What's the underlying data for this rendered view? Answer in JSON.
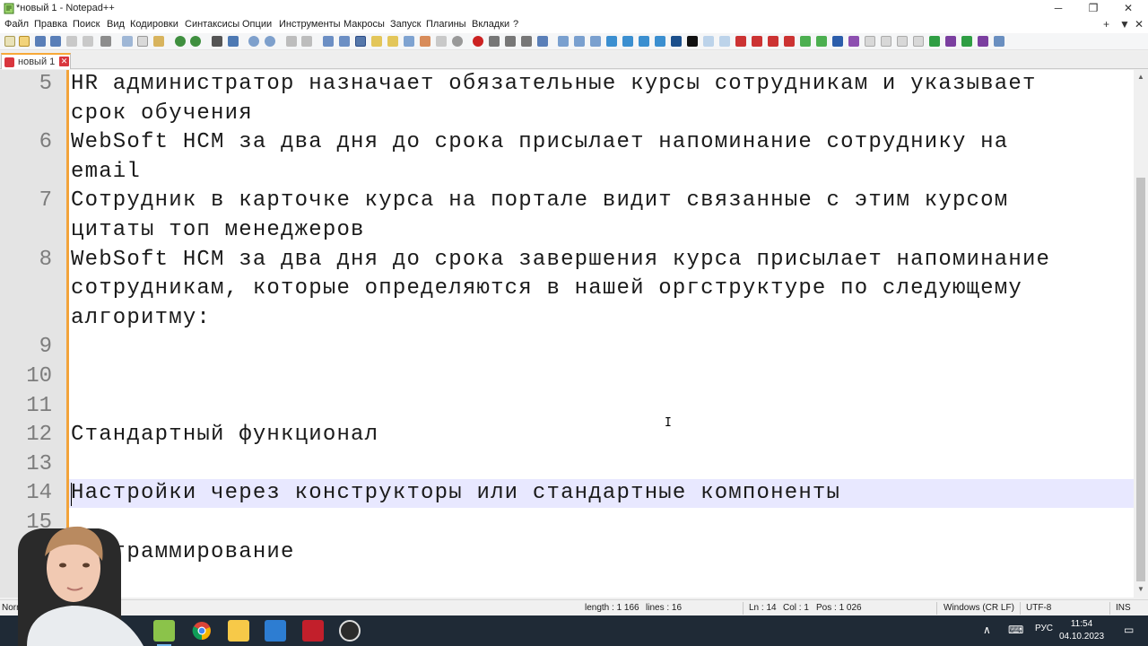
{
  "window": {
    "title": "*новый 1 - Notepad++"
  },
  "menu": [
    "Файл",
    "Правка",
    "Поиск",
    "Вид",
    "Кодировки",
    "Синтаксисы",
    "Опции",
    "Инструменты",
    "Макросы",
    "Запуск",
    "Плагины",
    "Вкладки",
    "?"
  ],
  "menu_right": {
    "add": "+",
    "dropdown": "▼",
    "close": "✕"
  },
  "tab": {
    "label": "новый 1"
  },
  "editor": {
    "lines": [
      {
        "num": "5",
        "text": "HR администратор назначает обязательные курсы сотрудникам и указывает"
      },
      {
        "num": "",
        "text": "срок обучения"
      },
      {
        "num": "6",
        "text": "WebSoft HCM за два дня до срока присылает напоминание сотруднику на"
      },
      {
        "num": "",
        "text": "email"
      },
      {
        "num": "7",
        "text": "Сотрудник в карточке курса на портале видит связанные с этим курсом"
      },
      {
        "num": "",
        "text": "цитаты топ менеджеров"
      },
      {
        "num": "8",
        "text": "WebSoft HCM за два дня до срока завершения курса присылает напоминание"
      },
      {
        "num": "",
        "text": "сотрудникам, которые определяются в нашей оргструктуре по следующему"
      },
      {
        "num": "",
        "text": "алгоритму:"
      },
      {
        "num": "9",
        "text": ""
      },
      {
        "num": "10",
        "text": ""
      },
      {
        "num": "11",
        "text": ""
      },
      {
        "num": "12",
        "text": "Стандартный функционал"
      },
      {
        "num": "13",
        "text": ""
      },
      {
        "num": "14",
        "text": "Настройки через конструкторы или стандартные компоненты"
      },
      {
        "num": "15",
        "text": ""
      },
      {
        "num": "",
        "text": "программирование"
      }
    ]
  },
  "status": {
    "type": "Norm",
    "length": "length : 1 166",
    "lines": "lines : 16",
    "ln": "Ln : 14",
    "col": "Col : 1",
    "pos": "Pos : 1 026",
    "eol": "Windows (CR LF)",
    "encoding": "UTF-8",
    "mode": "INS"
  },
  "taskbar": {
    "lang": "РУС",
    "time": "11:54",
    "date": "04.10.2023",
    "apps": [
      "notepad-plus-plus",
      "chrome",
      "file-explorer",
      "screen-app",
      "red-black-app",
      "obs"
    ]
  },
  "colors": {
    "accent": "#f7a838",
    "current_line": "#e8e8ff",
    "taskbar": "#1f2a36"
  }
}
